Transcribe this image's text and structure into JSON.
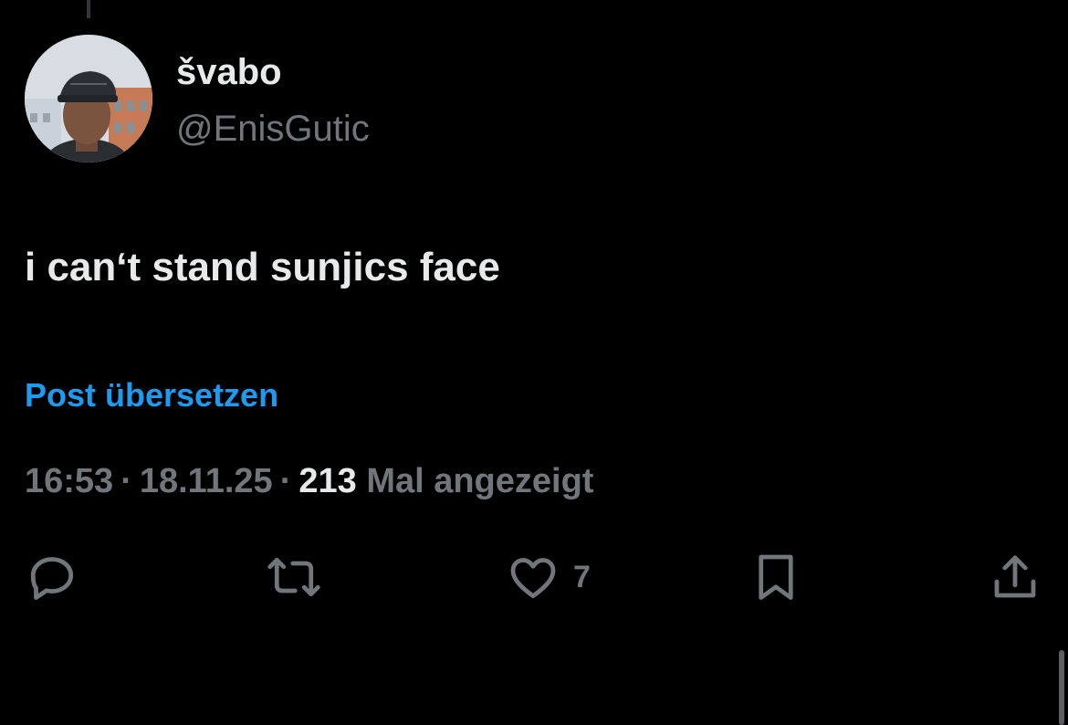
{
  "author": {
    "display_name": "švabo",
    "handle": "@EnisGutic"
  },
  "tweet": {
    "text": "i can‘t stand sunjics face",
    "translate_label": "Post übersetzen"
  },
  "meta": {
    "time": "16:53",
    "separator": "·",
    "date": "18.11.25",
    "views_count": "213",
    "views_label": "Mal angezeigt"
  },
  "actions": {
    "reply_icon": "reply-icon",
    "repost_icon": "repost-icon",
    "like_icon": "heart-icon",
    "like_count": "7",
    "bookmark_icon": "bookmark-icon",
    "share_icon": "share-icon"
  },
  "colors": {
    "background": "#000000",
    "text_primary": "#e7e9ea",
    "text_secondary": "#71767b",
    "accent": "#1d9bf0"
  }
}
